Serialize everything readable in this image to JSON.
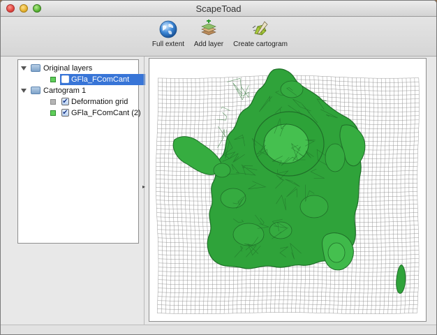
{
  "window": {
    "title": "ScapeToad"
  },
  "toolbar": {
    "full_extent_label": "Full extent",
    "add_layer_label": "Add layer",
    "create_cartogram_label": "Create cartogram"
  },
  "layers": {
    "original_group_label": "Original layers",
    "original_layer_label": "GFla_FComCant",
    "cartogram_group_label": "Cartogram 1",
    "deformation_grid_label": "Deformation grid",
    "cartogram_layer_label": "GFla_FComCant (2)"
  },
  "colors": {
    "map_fill": "#2fa33a",
    "map_fill_light": "#45c04f",
    "map_stroke": "#1f6e28",
    "grid_stroke": "#8c8c8c",
    "selection": "#3875d7"
  },
  "icons": {
    "full_extent": "globe-icon",
    "add_layer": "layers-icon",
    "create_cartogram": "cartogram-icon"
  }
}
